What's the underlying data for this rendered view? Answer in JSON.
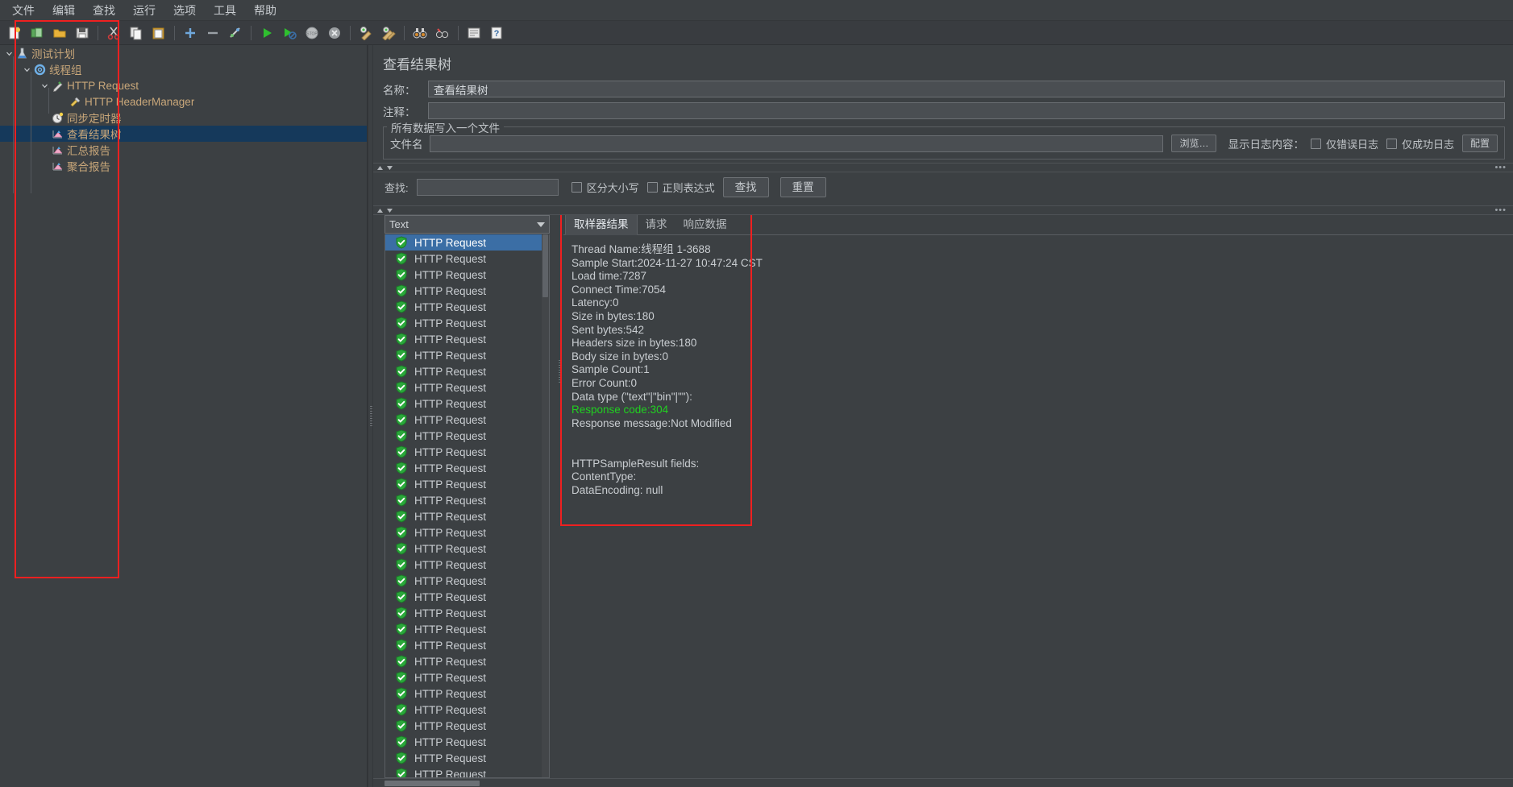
{
  "menu": {
    "items": [
      {
        "label": "文件",
        "name": "menu-file"
      },
      {
        "label": "编辑",
        "name": "menu-edit"
      },
      {
        "label": "查找",
        "name": "menu-search"
      },
      {
        "label": "运行",
        "name": "menu-run"
      },
      {
        "label": "选项",
        "name": "menu-options"
      },
      {
        "label": "工具",
        "name": "menu-tools"
      },
      {
        "label": "帮助",
        "name": "menu-help"
      }
    ]
  },
  "toolbar": {
    "icons": [
      "new-file-icon",
      "open-template-icon",
      "open-folder-icon",
      "save-icon",
      "cut-icon",
      "copy-icon",
      "paste-icon",
      "expand-all-icon",
      "collapse-all-icon",
      "toggle-icon",
      "start-icon",
      "start-no-pause-icon",
      "stop-icon",
      "shutdown-icon",
      "clear-icon",
      "clear-all-icon",
      "search-binoculars-icon",
      "reset-search-icon",
      "function-helper-icon",
      "help-icon"
    ]
  },
  "tree": {
    "items": [
      {
        "label": "测试计划",
        "icon": "test-plan-icon",
        "depth": 0,
        "twisty": "v",
        "selected": false,
        "name": "tree-item-test-plan"
      },
      {
        "label": "线程组",
        "icon": "thread-group-icon",
        "depth": 1,
        "twisty": "v",
        "selected": false,
        "name": "tree-item-thread-group"
      },
      {
        "label": "HTTP Request",
        "icon": "http-request-icon",
        "depth": 2,
        "twisty": "v",
        "selected": false,
        "name": "tree-item-http-request"
      },
      {
        "label": "HTTP HeaderManager",
        "icon": "header-manager-icon",
        "depth": 3,
        "twisty": "",
        "selected": false,
        "name": "tree-item-http-headermanager"
      },
      {
        "label": "同步定时器",
        "icon": "timer-icon",
        "depth": 2,
        "twisty": "",
        "selected": false,
        "name": "tree-item-sync-timer"
      },
      {
        "label": "查看结果树",
        "icon": "view-results-tree-icon",
        "depth": 2,
        "twisty": "",
        "selected": true,
        "name": "tree-item-view-results-tree"
      },
      {
        "label": "汇总报告",
        "icon": "summary-report-icon",
        "depth": 2,
        "twisty": "",
        "selected": false,
        "name": "tree-item-summary-report"
      },
      {
        "label": "聚合报告",
        "icon": "aggregate-report-icon",
        "depth": 2,
        "twisty": "",
        "selected": false,
        "name": "tree-item-aggregate-report"
      }
    ]
  },
  "panel": {
    "title": "查看结果树",
    "name_label": "名称：",
    "name_value": "查看结果树",
    "comment_label": "注释：",
    "comment_value": "",
    "filegroup_legend": "所有数据写入一个文件",
    "filename_label": "文件名",
    "filename_value": "",
    "browse_button": "浏览…",
    "log_display_label": "显示日志内容：",
    "error_log_only": "仅错误日志",
    "success_log_only": "仅成功日志",
    "configure_button": "配置"
  },
  "search": {
    "label": "查找:",
    "value": "",
    "case_sensitive": "区分大小写",
    "regexp": "正则表达式",
    "find_button": "查找",
    "reset_button": "重置"
  },
  "results": {
    "renderer_selected": "Text",
    "rows": [
      {
        "label": "HTTP Request",
        "status": "success",
        "selected": true
      },
      {
        "label": "HTTP Request",
        "status": "success",
        "selected": false
      },
      {
        "label": "HTTP Request",
        "status": "success",
        "selected": false
      },
      {
        "label": "HTTP Request",
        "status": "success",
        "selected": false
      },
      {
        "label": "HTTP Request",
        "status": "success",
        "selected": false
      },
      {
        "label": "HTTP Request",
        "status": "success",
        "selected": false
      },
      {
        "label": "HTTP Request",
        "status": "success",
        "selected": false
      },
      {
        "label": "HTTP Request",
        "status": "success",
        "selected": false
      },
      {
        "label": "HTTP Request",
        "status": "success",
        "selected": false
      },
      {
        "label": "HTTP Request",
        "status": "success",
        "selected": false
      },
      {
        "label": "HTTP Request",
        "status": "success",
        "selected": false
      },
      {
        "label": "HTTP Request",
        "status": "success",
        "selected": false
      },
      {
        "label": "HTTP Request",
        "status": "success",
        "selected": false
      },
      {
        "label": "HTTP Request",
        "status": "success",
        "selected": false
      },
      {
        "label": "HTTP Request",
        "status": "success",
        "selected": false
      },
      {
        "label": "HTTP Request",
        "status": "success",
        "selected": false
      },
      {
        "label": "HTTP Request",
        "status": "success",
        "selected": false
      },
      {
        "label": "HTTP Request",
        "status": "success",
        "selected": false
      },
      {
        "label": "HTTP Request",
        "status": "success",
        "selected": false
      },
      {
        "label": "HTTP Request",
        "status": "success",
        "selected": false
      },
      {
        "label": "HTTP Request",
        "status": "success",
        "selected": false
      },
      {
        "label": "HTTP Request",
        "status": "success",
        "selected": false
      },
      {
        "label": "HTTP Request",
        "status": "success",
        "selected": false
      },
      {
        "label": "HTTP Request",
        "status": "success",
        "selected": false
      },
      {
        "label": "HTTP Request",
        "status": "success",
        "selected": false
      },
      {
        "label": "HTTP Request",
        "status": "success",
        "selected": false
      },
      {
        "label": "HTTP Request",
        "status": "success",
        "selected": false
      },
      {
        "label": "HTTP Request",
        "status": "success",
        "selected": false
      },
      {
        "label": "HTTP Request",
        "status": "success",
        "selected": false
      },
      {
        "label": "HTTP Request",
        "status": "success",
        "selected": false
      },
      {
        "label": "HTTP Request",
        "status": "success",
        "selected": false
      },
      {
        "label": "HTTP Request",
        "status": "success",
        "selected": false
      },
      {
        "label": "HTTP Request",
        "status": "success",
        "selected": false
      },
      {
        "label": "HTTP Request",
        "status": "success",
        "selected": false
      }
    ]
  },
  "detail": {
    "tabs": [
      {
        "label": "取样器结果",
        "active": true,
        "name": "tab-sampler-result"
      },
      {
        "label": "请求",
        "active": false,
        "name": "tab-request"
      },
      {
        "label": "响应数据",
        "active": false,
        "name": "tab-response-data"
      }
    ],
    "lines": [
      {
        "text": "Thread Name:线程组 1-3688",
        "style": "normal"
      },
      {
        "text": "Sample Start:2024-11-27 10:47:24 CST",
        "style": "normal"
      },
      {
        "text": "Load time:7287",
        "style": "normal"
      },
      {
        "text": "Connect Time:7054",
        "style": "normal"
      },
      {
        "text": "Latency:0",
        "style": "normal"
      },
      {
        "text": "Size in bytes:180",
        "style": "normal"
      },
      {
        "text": "Sent bytes:542",
        "style": "normal"
      },
      {
        "text": "Headers size in bytes:180",
        "style": "normal"
      },
      {
        "text": "Body size in bytes:0",
        "style": "normal"
      },
      {
        "text": "Sample Count:1",
        "style": "normal"
      },
      {
        "text": "Error Count:0",
        "style": "normal"
      },
      {
        "text": "Data type (\"text\"|\"bin\"|\"\"):",
        "style": "normal"
      },
      {
        "text": "Response code:304",
        "style": "green"
      },
      {
        "text": "Response message:Not Modified",
        "style": "normal"
      },
      {
        "text": " ",
        "style": "blank"
      },
      {
        "text": " ",
        "style": "blank"
      },
      {
        "text": "HTTPSampleResult fields:",
        "style": "normal"
      },
      {
        "text": "ContentType:",
        "style": "normal"
      },
      {
        "text": "DataEncoding: null",
        "style": "normal"
      }
    ]
  },
  "colors": {
    "background": "#3c4043",
    "tree_text": "#c9a77a",
    "selection_blue": "#3b6ea5",
    "tree_selection": "#15395b",
    "annotation_red": "#ef2020",
    "response_code_green": "#20d020"
  }
}
